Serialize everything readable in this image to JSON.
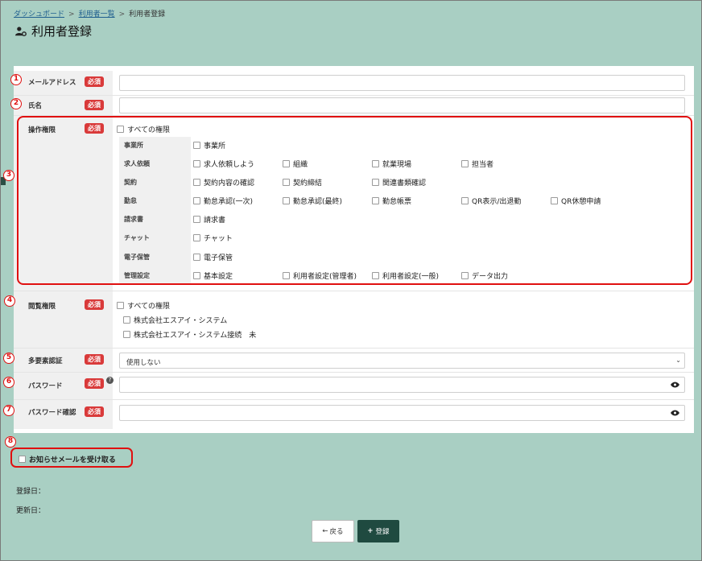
{
  "breadcrumb": {
    "dashboard": "ダッシュボード",
    "user_list": "利用者一覧",
    "current": "利用者登録",
    "sep": ">"
  },
  "page_title": "利用者登録",
  "required": "必須",
  "fields": {
    "email": {
      "label": "メールアドレス",
      "num": "1"
    },
    "name": {
      "label": "氏名",
      "num": "2"
    },
    "operation": {
      "label": "操作権限",
      "num": "3",
      "all": "すべての権限"
    },
    "view": {
      "label": "閲覧権限",
      "num": "4",
      "all": "すべての権限",
      "options": [
        "株式会社エスアイ・システム",
        "株式会社エスアイ・システム接続　未"
      ]
    },
    "mfa": {
      "label": "多要素認証",
      "num": "5",
      "value": "使用しない"
    },
    "password": {
      "label": "パスワード",
      "num": "6"
    },
    "password_confirm": {
      "label": "パスワード確認",
      "num": "7"
    }
  },
  "permissions": [
    {
      "label": "事業所",
      "items": [
        "事業所"
      ]
    },
    {
      "label": "求人依頼",
      "items": [
        "求人依頼しよう",
        "組織",
        "就業現場",
        "担当者"
      ]
    },
    {
      "label": "契約",
      "items": [
        "契約内容の確認",
        "契約締結",
        "関連書類確認"
      ]
    },
    {
      "label": "勤怠",
      "items": [
        "勤怠承認(一次)",
        "勤怠承認(最終)",
        "勤怠帳票",
        "QR表示/出退勤",
        "QR休憩申請"
      ]
    },
    {
      "label": "請求書",
      "items": [
        "請求書"
      ]
    },
    {
      "label": "チャット",
      "items": [
        "チャット"
      ]
    },
    {
      "label": "電子保管",
      "items": [
        "電子保管"
      ]
    },
    {
      "label": "管理設定",
      "items": [
        "基本設定",
        "利用者設定(管理者)",
        "利用者設定(一般)",
        "データ出力"
      ]
    }
  ],
  "notify": {
    "num": "8",
    "label": "お知らせメールを受け取る"
  },
  "meta": {
    "registered": "登録日：",
    "updated": "更新日："
  },
  "buttons": {
    "back": "戻る",
    "back_icon": "←",
    "register": "登録",
    "register_icon": "+"
  },
  "colors": {
    "background": "#a9cfc3",
    "accent": "#1f4a40",
    "required": "#d93a3a",
    "highlight": "#e01010"
  }
}
